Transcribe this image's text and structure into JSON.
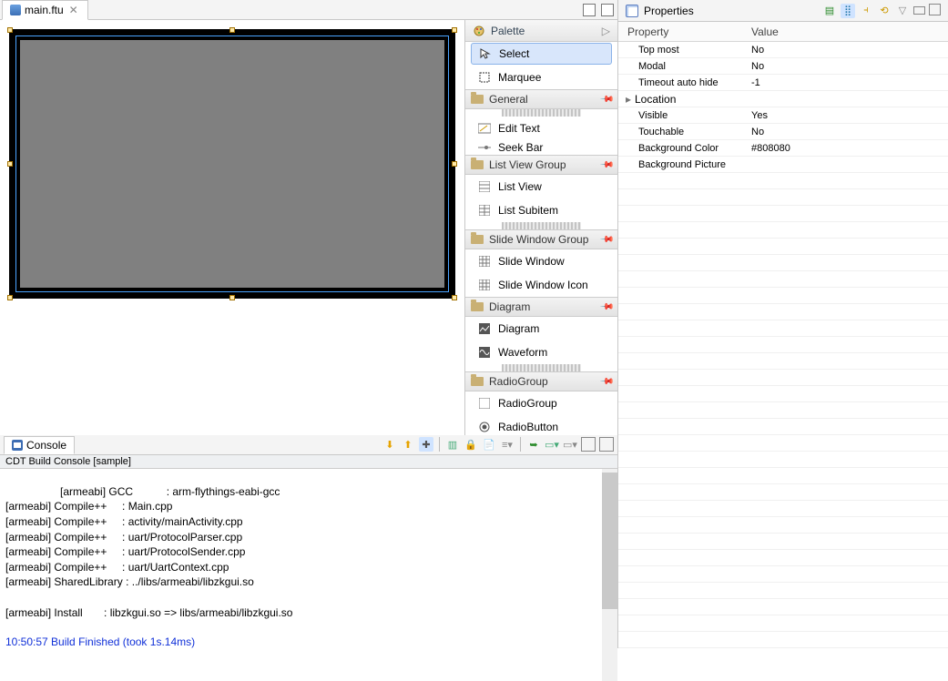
{
  "editor": {
    "tab_title": "main.ftu"
  },
  "palette": {
    "title": "Palette",
    "tool_select": "Select",
    "tool_marquee": "Marquee",
    "sec_general": "General",
    "item_edit_text": "Edit Text",
    "item_seek_bar": "Seek Bar",
    "sec_listview": "List View Group",
    "item_list_view": "List View",
    "item_list_subitem": "List Subitem",
    "sec_slidewin": "Slide Window Group",
    "item_slide_window": "Slide Window",
    "item_slide_window_icon": "Slide Window Icon",
    "sec_diagram": "Diagram",
    "item_diagram": "Diagram",
    "item_waveform": "Waveform",
    "sec_radiogroup": "RadioGroup",
    "item_radiogroup": "RadioGroup",
    "item_radiobutton": "RadioButton"
  },
  "properties": {
    "view_title": "Properties",
    "col_property": "Property",
    "col_value": "Value",
    "rows": {
      "top_most": {
        "label": "Top most",
        "value": "No"
      },
      "modal": {
        "label": "Modal",
        "value": "No"
      },
      "timeout": {
        "label": "Timeout auto hide",
        "value": "-1"
      },
      "location": {
        "label": "Location",
        "value": ""
      },
      "visible": {
        "label": "Visible",
        "value": "Yes"
      },
      "touchable": {
        "label": "Touchable",
        "value": "No"
      },
      "bgcolor": {
        "label": "Background Color",
        "value": "#808080"
      },
      "bgpic": {
        "label": "Background Picture",
        "value": ""
      }
    }
  },
  "console": {
    "view_title": "Console",
    "subtitle": "CDT Build Console [sample]",
    "lines": "[armeabi] GCC           : arm-flythings-eabi-gcc\n[armeabi] Compile++     : Main.cpp\n[armeabi] Compile++     : activity/mainActivity.cpp\n[armeabi] Compile++     : uart/ProtocolParser.cpp\n[armeabi] Compile++     : uart/ProtocolSender.cpp\n[armeabi] Compile++     : uart/UartContext.cpp\n[armeabi] SharedLibrary : ../libs/armeabi/libzkgui.so\n\n[armeabi] Install       : libzkgui.so => libs/armeabi/libzkgui.so\n",
    "finish_line": "10:50:57 Build Finished (took 1s.14ms)"
  }
}
